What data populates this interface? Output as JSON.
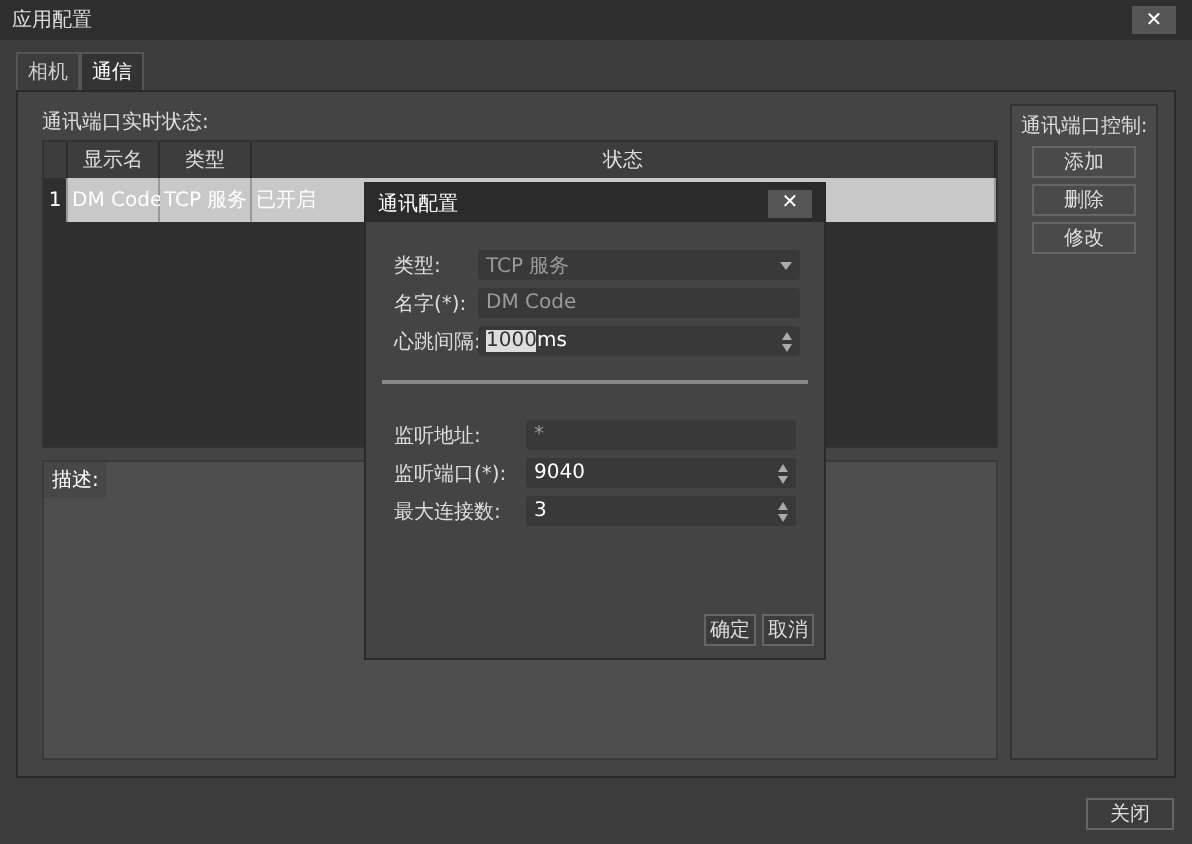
{
  "window": {
    "title": "应用配置",
    "close": "✕"
  },
  "tabs": [
    {
      "label": "相机",
      "selected": false
    },
    {
      "label": "通信",
      "selected": true
    }
  ],
  "status_label": "通讯端口实时状态:",
  "table": {
    "columns": [
      "显示名",
      "类型",
      "状态"
    ],
    "rows": [
      {
        "index": "1",
        "cells": [
          "DM Code",
          "TCP 服务",
          "已开启"
        ],
        "selected": true
      }
    ]
  },
  "description": {
    "label": "描述:"
  },
  "controls": {
    "label": "通讯端口控制:",
    "buttons": [
      "添加",
      "删除",
      "修改"
    ]
  },
  "footer": {
    "button": "关闭"
  },
  "dialog": {
    "title": "通讯配置",
    "close": "✕",
    "fields": [
      {
        "kind": "dropdown",
        "label": "类型:",
        "value": "TCP 服务",
        "disabled": true
      },
      {
        "kind": "text",
        "label": "名字(*):",
        "value": "DM Code",
        "disabled": true
      },
      {
        "kind": "spin",
        "label": "心跳间隔:",
        "value": "1000",
        "suffix": "ms",
        "disabled": false
      }
    ],
    "listen_fields": [
      {
        "kind": "text",
        "label": "监听地址:",
        "value": "*",
        "disabled": true
      },
      {
        "kind": "spin",
        "label": "监听端口(*):",
        "value": "9040",
        "disabled": false
      },
      {
        "kind": "spin",
        "label": "最大连接数:",
        "value": "3",
        "disabled": false
      }
    ],
    "buttons": [
      "确定",
      "取消"
    ]
  }
}
